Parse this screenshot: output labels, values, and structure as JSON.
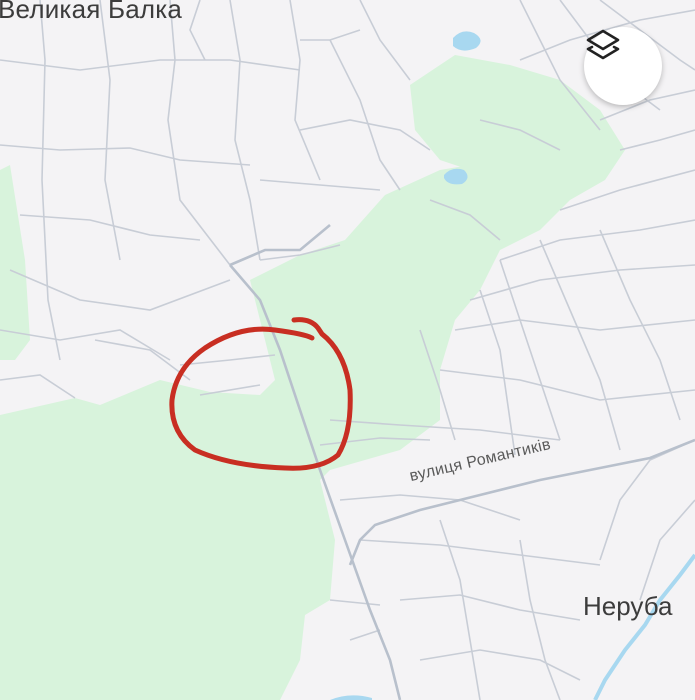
{
  "map": {
    "places": {
      "top_left": "Великая Балка",
      "bottom_right": "Неруба"
    },
    "streets": {
      "romantykiv": "вулиця Романтиків"
    },
    "layers_icon": "layers-icon",
    "colors": {
      "background": "#f4f3f5",
      "park": "#d8f3dc",
      "road": "#c8cdd6",
      "major_road": "#b8c0cc",
      "water": "#a8d8f0",
      "annotation": "#c82e22"
    }
  }
}
